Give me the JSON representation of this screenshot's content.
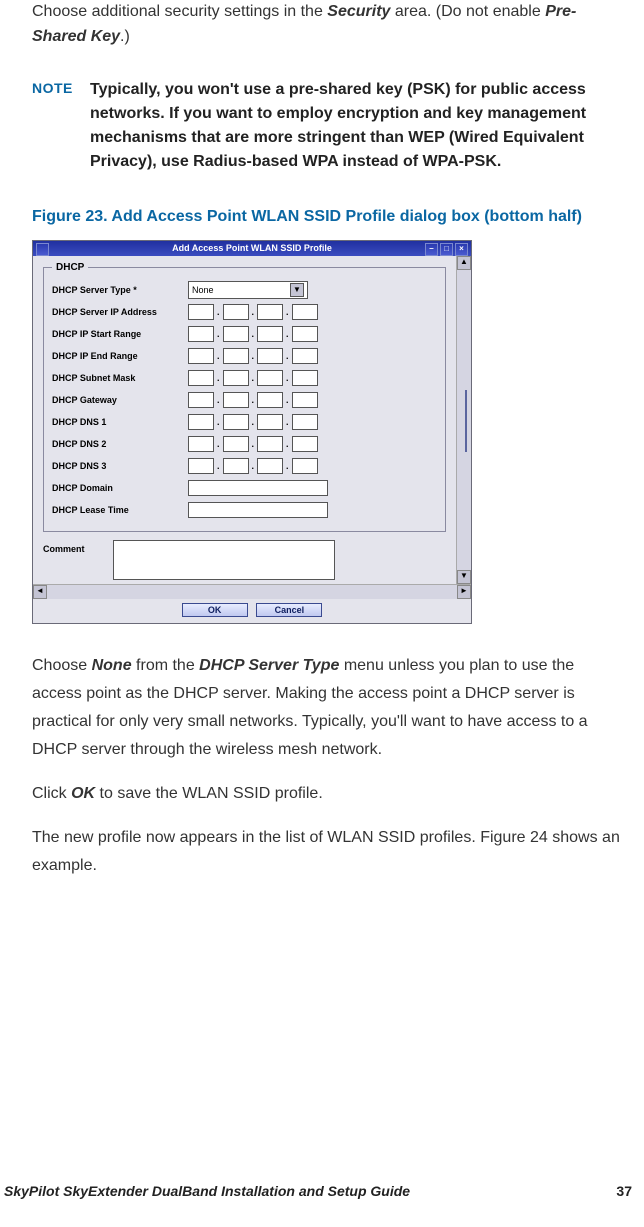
{
  "intro": {
    "pre": "Choose additional security settings in the ",
    "sec": "Security",
    "mid": " area. (Do not enable ",
    "psk": "Pre-Shared Key",
    "post": ".)"
  },
  "note": {
    "label": "NOTE",
    "text": "Typically, you won't use a pre-shared key (PSK) for public access networks. If you want to employ encryption and key management mechanisms that are more stringent than WEP (Wired Equivalent Privacy), use Radius-based WPA instead of WPA-PSK."
  },
  "figure_caption": "Figure 23. Add Access Point WLAN SSID Profile dialog box (bottom half)",
  "dialog": {
    "title": "Add Access Point WLAN SSID Profile",
    "group_dhcp": "DHCP",
    "labels": {
      "server_type": "DHCP Server Type *",
      "server_ip": "DHCP Server IP Address",
      "ip_start": "DHCP IP Start Range",
      "ip_end": "DHCP IP End Range",
      "subnet": "DHCP Subnet Mask",
      "gateway": "DHCP Gateway",
      "dns1": "DHCP DNS 1",
      "dns2": "DHCP DNS 2",
      "dns3": "DHCP DNS 3",
      "domain": "DHCP Domain",
      "lease": "DHCP Lease Time",
      "comment": "Comment"
    },
    "server_type_value": "None",
    "buttons": {
      "ok": "OK",
      "cancel": "Cancel"
    }
  },
  "para1": {
    "a": "Choose ",
    "none": "None",
    "b": " from the ",
    "menu": "DHCP Server Type",
    "c": " menu unless you plan to use the access point as the DHCP server. Making the access point a DHCP server is practical for only very small networks. Typically, you'll want to have access to a DHCP server through the wireless mesh network."
  },
  "para2": {
    "a": "Click ",
    "ok": "OK",
    "b": " to save the WLAN SSID profile."
  },
  "para3": "The new profile now appears in the list of WLAN SSID profiles. Figure 24 shows an example.",
  "footer": {
    "title": "SkyPilot SkyExtender DualBand Installation and Setup Guide",
    "page": "37"
  }
}
